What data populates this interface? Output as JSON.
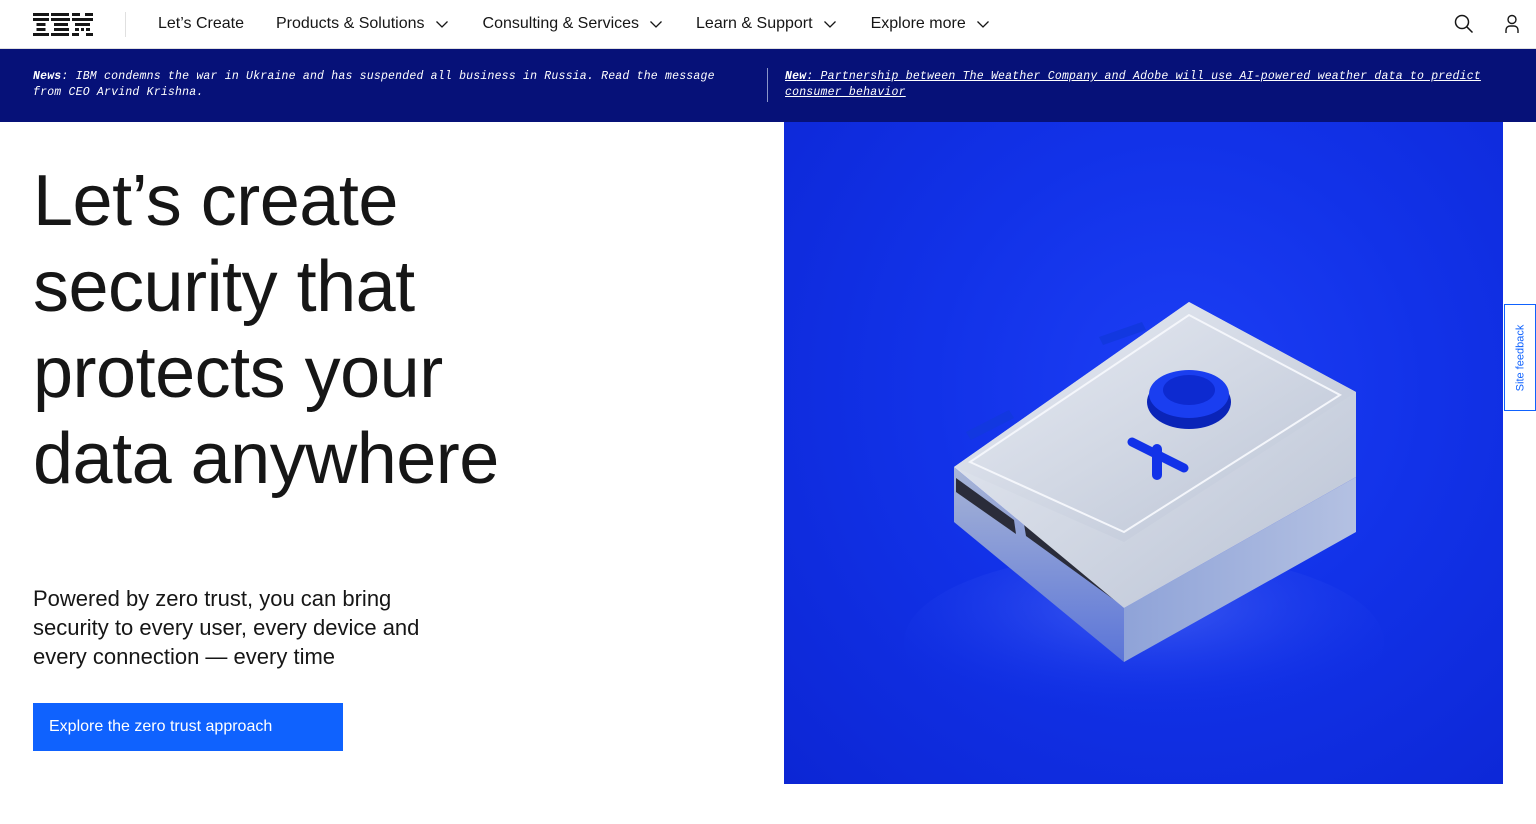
{
  "brand": {
    "name": "IBM"
  },
  "nav": {
    "items": [
      {
        "label": "Let’s Create",
        "has_dropdown": false
      },
      {
        "label": "Products & Solutions",
        "has_dropdown": true
      },
      {
        "label": "Consulting & Services",
        "has_dropdown": true
      },
      {
        "label": "Learn & Support",
        "has_dropdown": true
      },
      {
        "label": "Explore more",
        "has_dropdown": true
      }
    ]
  },
  "masthead_icons": [
    "search-icon",
    "user-icon"
  ],
  "news": {
    "left_prefix": "News",
    "left_text": ": IBM condemns the war in Ukraine and has suspended all business in Russia. Read the message from CEO Arvind Krishna.",
    "right_prefix": "New",
    "right_text": ": Partnership between The Weather Company and Adobe will use AI-powered weather data to predict consumer behavior"
  },
  "hero": {
    "title": "Let’s create security that protects your data anywhere",
    "subtitle": "Powered by zero trust, you can bring security to every user, every device and every connection — every time",
    "cta_label": "Explore the zero trust approach"
  },
  "feedback": {
    "label": "Site feedback"
  },
  "colors": {
    "newsbar": "#061178",
    "cta": "#0f62fe",
    "hero_blue": "#1232e8",
    "text": "#161616"
  }
}
